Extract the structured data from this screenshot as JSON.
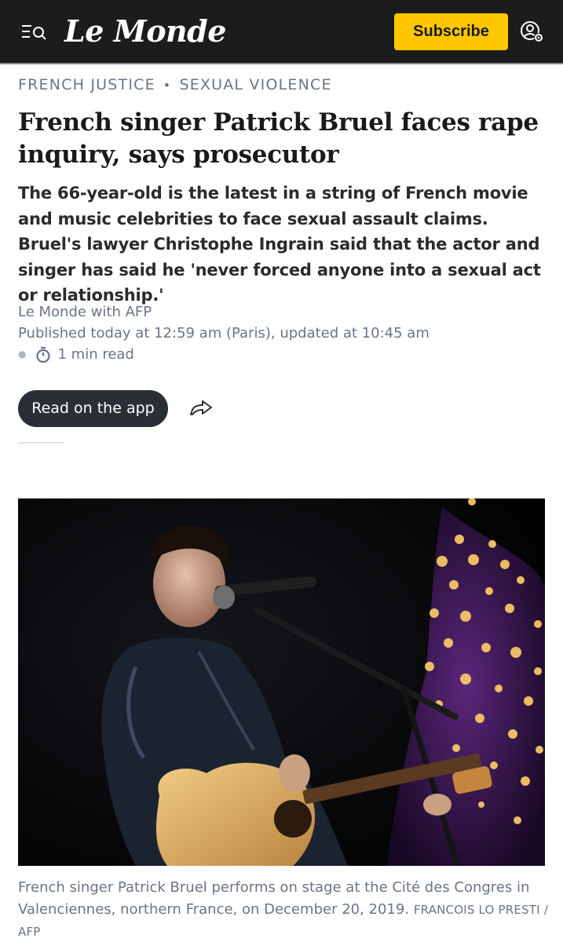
{
  "header": {
    "logo": "Le Monde",
    "subscribe_label": "Subscribe",
    "menu_icon": "menu-search-icon",
    "account_icon": "account-settings-icon",
    "bg_color": "#1b1c1e",
    "accent_color": "#ffc700"
  },
  "breadcrumb": {
    "items": [
      "FRENCH JUSTICE",
      "SEXUAL VIOLENCE"
    ],
    "separator": "•"
  },
  "article": {
    "headline": "French singer Patrick Bruel faces rape inquiry, says prosecutor",
    "standfirst": "The 66-year-old is the latest in a string of French movie and music celebrities to face sexual assault claims. Bruel's lawyer Christophe Ingrain said that the actor and singer has said he 'never forced anyone into a sexual act or relationship.'",
    "byline": "Le Monde with AFP",
    "published": "Published today at 12:59 am (Paris), updated at 10:45 am",
    "read_time": "1 min read",
    "read_app_label": "Read on the app",
    "share_icon": "share-icon",
    "timer_icon": "stopwatch-icon"
  },
  "photo": {
    "caption": "French singer Patrick Bruel performs on stage at the Cité des Congres in Valenciennes, northern France, on December 20, 2019.",
    "credit": "FRANCOIS LO PRESTI / AFP"
  }
}
